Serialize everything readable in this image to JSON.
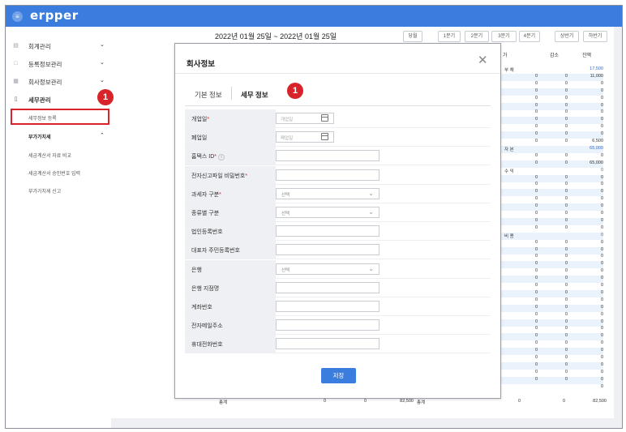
{
  "app": {
    "logo": "erpper",
    "menu_icon": "menu-icon"
  },
  "sidebar": {
    "items": [
      {
        "label": "회계관리",
        "icon": "chart-icon",
        "chevron": "⌄"
      },
      {
        "label": "등록정보관리",
        "icon": "monitor-icon",
        "chevron": "⌄"
      },
      {
        "label": "회사정보관리",
        "icon": "building-icon",
        "chevron": "⌄"
      },
      {
        "label": "세무관리",
        "icon": "document-icon",
        "chevron": ""
      }
    ],
    "selected_sub": "세무정보 등록",
    "vat_group": {
      "label": "부가가치세",
      "chevron": "⌃"
    },
    "vat_items": [
      "세금계산서 자료 비교",
      "세금계산서 승인번호 입력",
      "부가가치세 신고"
    ]
  },
  "annotation": {
    "badge": "1"
  },
  "background": {
    "date_range": "2022년 01월 25일  ~  2022년 01월 25일",
    "quick_buttons": [
      "당월",
      "1분기",
      "2분기",
      "3분기",
      "4분기",
      "상반기",
      "하반기"
    ],
    "col_headers": [
      "가",
      "감소",
      "잔액"
    ],
    "rows": [
      {
        "sec": "부  채",
        "a": "",
        "b": "",
        "c": "17,500",
        "blue": true
      },
      {
        "a": "0",
        "b": "0",
        "c": "11,000"
      },
      {
        "a": "0",
        "b": "0",
        "c": "0"
      },
      {
        "a": "0",
        "b": "0",
        "c": "0"
      },
      {
        "a": "0",
        "b": "0",
        "c": "0"
      },
      {
        "a": "0",
        "b": "0",
        "c": "0"
      },
      {
        "a": "0",
        "b": "0",
        "c": "0"
      },
      {
        "a": "0",
        "b": "0",
        "c": "0"
      },
      {
        "a": "0",
        "b": "0",
        "c": "0"
      },
      {
        "a": "0",
        "b": "0",
        "c": "0"
      },
      {
        "a": "0",
        "b": "0",
        "c": "6,500"
      },
      {
        "sec": "자  본",
        "a": "",
        "b": "",
        "c": "65,000",
        "blue": true
      },
      {
        "a": "0",
        "b": "0",
        "c": "0"
      },
      {
        "a": "0",
        "b": "0",
        "c": "65,000"
      },
      {
        "sec": "수  익",
        "a": "",
        "b": "",
        "c": "0",
        "blue": true
      },
      {
        "a": "0",
        "b": "0",
        "c": "0"
      },
      {
        "a": "0",
        "b": "0",
        "c": "0"
      },
      {
        "a": "0",
        "b": "0",
        "c": "0"
      },
      {
        "a": "0",
        "b": "0",
        "c": "0"
      },
      {
        "a": "0",
        "b": "0",
        "c": "0"
      },
      {
        "a": "0",
        "b": "0",
        "c": "0"
      },
      {
        "a": "0",
        "b": "0",
        "c": "0"
      },
      {
        "a": "0",
        "b": "0",
        "c": "0"
      },
      {
        "sec": "비  용",
        "a": "",
        "b": "",
        "c": "0",
        "blue": true
      },
      {
        "a": "0",
        "b": "0",
        "c": "0"
      },
      {
        "a": "0",
        "b": "0",
        "c": "0"
      },
      {
        "a": "0",
        "b": "0",
        "c": "0"
      },
      {
        "a": "0",
        "b": "0",
        "c": "0"
      },
      {
        "a": "0",
        "b": "0",
        "c": "0"
      },
      {
        "a": "0",
        "b": "0",
        "c": "0"
      },
      {
        "a": "0",
        "b": "0",
        "c": "0"
      },
      {
        "a": "0",
        "b": "0",
        "c": "0"
      },
      {
        "a": "0",
        "b": "0",
        "c": "0"
      },
      {
        "a": "0",
        "b": "0",
        "c": "0"
      },
      {
        "a": "0",
        "b": "0",
        "c": "0"
      },
      {
        "a": "0",
        "b": "0",
        "c": "0"
      },
      {
        "a": "0",
        "b": "0",
        "c": "0"
      },
      {
        "a": "0",
        "b": "0",
        "c": "0"
      },
      {
        "a": "0",
        "b": "0",
        "c": "0"
      },
      {
        "a": "0",
        "b": "0",
        "c": "0"
      },
      {
        "a": "0",
        "b": "0",
        "c": "0"
      },
      {
        "a": "0",
        "b": "0",
        "c": "0"
      },
      {
        "a": "0",
        "b": "0",
        "c": "0"
      },
      {
        "a": "0",
        "b": "0",
        "c": "0"
      },
      {
        "a": "",
        "b": "",
        "c": "0"
      }
    ],
    "footer": {
      "label1": "총계",
      "v1": "0",
      "v2": "0",
      "v3": "82,500",
      "label2": "총계",
      "v4": "0",
      "v5": "0",
      "v6": "82,500"
    }
  },
  "modal": {
    "title": "회사정보",
    "close_icon": "✕",
    "tabs": [
      "기본 정보",
      "세무 정보"
    ],
    "active_tab": 1,
    "fields": [
      {
        "label": "개업일",
        "required": true,
        "type": "date",
        "placeholder": "개업일"
      },
      {
        "label": "폐업일",
        "required": false,
        "type": "date",
        "placeholder": "폐업일"
      },
      {
        "label": "홈택스 ID",
        "required": true,
        "info": "i",
        "type": "text",
        "placeholder": ""
      },
      {
        "label": "전자신고파일 비밀번호",
        "required": true,
        "type": "text",
        "placeholder": ""
      },
      {
        "label": "과세자 구분",
        "required": true,
        "type": "select",
        "placeholder": "선택"
      },
      {
        "label": "종류별 구분",
        "required": false,
        "type": "select",
        "placeholder": "선택"
      },
      {
        "label": "법인등록번호",
        "required": false,
        "type": "text",
        "placeholder": ""
      },
      {
        "label": "대표자 주민등록번호",
        "required": false,
        "type": "text",
        "placeholder": ""
      },
      {
        "label": "은행",
        "required": false,
        "type": "select",
        "placeholder": "선택"
      },
      {
        "label": "은행 지점명",
        "required": false,
        "type": "text",
        "placeholder": ""
      },
      {
        "label": "계좌번호",
        "required": false,
        "type": "text",
        "placeholder": ""
      },
      {
        "label": "전자메일주소",
        "required": false,
        "type": "text",
        "placeholder": ""
      },
      {
        "label": "휴대전화번호",
        "required": false,
        "type": "text",
        "placeholder": ""
      }
    ],
    "save_label": "저장"
  },
  "colors": {
    "brand": "#3b7dde",
    "annotation": "#d8232a",
    "required": "#d8232a"
  }
}
